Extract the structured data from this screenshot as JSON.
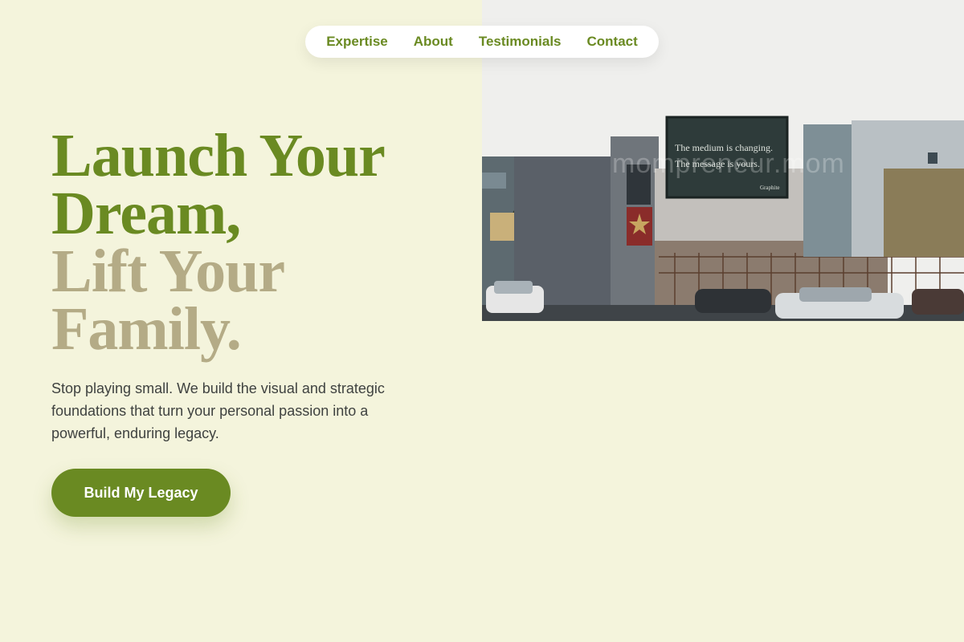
{
  "nav": {
    "items": [
      {
        "label": "Expertise"
      },
      {
        "label": "About"
      },
      {
        "label": "Testimonials"
      },
      {
        "label": "Contact"
      }
    ]
  },
  "hero": {
    "headline_line1": "Launch Your",
    "headline_line2": "Dream,",
    "headline_line3": "Lift Your",
    "headline_line4": "Family.",
    "subtitle": "Stop playing small. We build the visual and strategic foundations that turn your personal passion into a powerful, enduring legacy.",
    "cta_label": "Build My Legacy"
  },
  "photo": {
    "billboard_line1": "The medium is changing.",
    "billboard_line2": "The message is yours.",
    "billboard_brand": "Graphite",
    "watermark": "mompreneur.mom"
  },
  "colors": {
    "background": "#f4f4dc",
    "accent": "#6a8a22",
    "headline_muted": "#b4ab86",
    "body_text": "#3f4240"
  }
}
